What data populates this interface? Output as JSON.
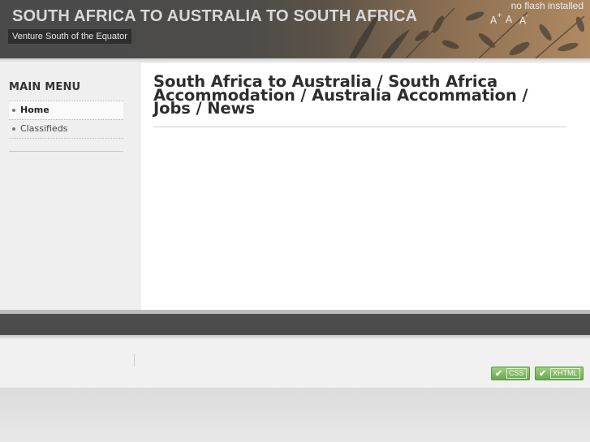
{
  "header": {
    "site_title": "SOUTH AFRICA TO AUSTRALIA TO SOUTH AFRICA",
    "slogan": "Venture South of the Equator",
    "flash_note": "no flash installed",
    "font_sizer": {
      "increase_label": "A",
      "increase_mark": "+",
      "reset_label": "A",
      "decrease_label": "A",
      "decrease_mark": "-"
    }
  },
  "sidebar": {
    "menu_title": "MAIN MENU",
    "items": [
      {
        "label": "Home",
        "active": true
      },
      {
        "label": "Classifieds",
        "active": false
      }
    ]
  },
  "main": {
    "heading": "South Africa to Australia / South Africa Accommodation / Australia Accommation / Jobs / News"
  },
  "footer": {
    "badges": [
      {
        "label": "CSS",
        "icon": "check-icon"
      },
      {
        "label": "XHTML",
        "icon": "check-icon"
      }
    ]
  },
  "colors": {
    "header_bg": "#4a4a4a",
    "footer_bar": "#4c4c4c",
    "badge_green": "#7ab85d"
  }
}
